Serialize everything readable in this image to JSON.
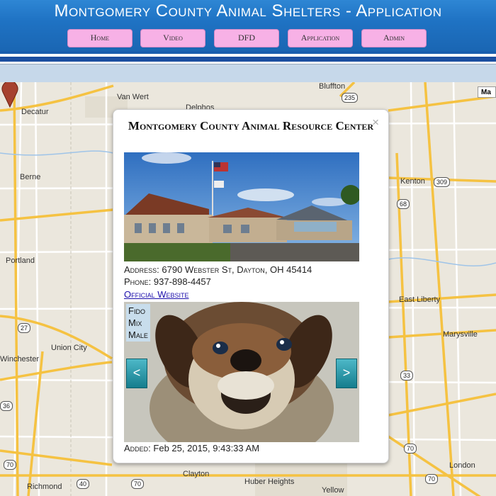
{
  "header": {
    "title": "Montgomery County Animal Shelters - Application",
    "nav": [
      {
        "label": "Home"
      },
      {
        "label": "Video"
      },
      {
        "label": "DFD"
      },
      {
        "label": "Application"
      },
      {
        "label": "Admin"
      }
    ]
  },
  "map": {
    "cities": [
      {
        "name": "Van Wert"
      },
      {
        "name": "Bluffton"
      },
      {
        "name": "Decatur"
      },
      {
        "name": "Delphos"
      },
      {
        "name": "Berne"
      },
      {
        "name": "Kenton"
      },
      {
        "name": "Portland"
      },
      {
        "name": "East Liberty"
      },
      {
        "name": "Union City"
      },
      {
        "name": "Marysville"
      },
      {
        "name": "Winchester"
      },
      {
        "name": "Clayton"
      },
      {
        "name": "London"
      },
      {
        "name": "Richmond"
      },
      {
        "name": "Huber Heights"
      },
      {
        "name": "Yellow"
      }
    ],
    "routes": [
      "235",
      "309",
      "68",
      "27",
      "33",
      "70",
      "40",
      "70",
      "70",
      "70",
      "36"
    ],
    "map_type_label": "Ma",
    "colors": {
      "road_major": "#f5c242",
      "road_minor": "#ffffff",
      "land": "#ebe7dd",
      "urban": "#e2ddd0"
    }
  },
  "popup": {
    "close_label": "×",
    "title": "Montgomery County Animal Resource Center",
    "address_label": "Address:",
    "address_value": "6790 Webster St, Dayton, OH 45414",
    "phone_label": "Phone:",
    "phone_value": "937-898-4457",
    "website_label": "Official Website",
    "pet": {
      "name": "Fido",
      "breed": "Mix",
      "sex": "Male"
    },
    "prev_label": "<",
    "next_label": ">",
    "added_label": "Added:",
    "added_value": "Feb 25, 2015, 9:43:33 AM"
  }
}
